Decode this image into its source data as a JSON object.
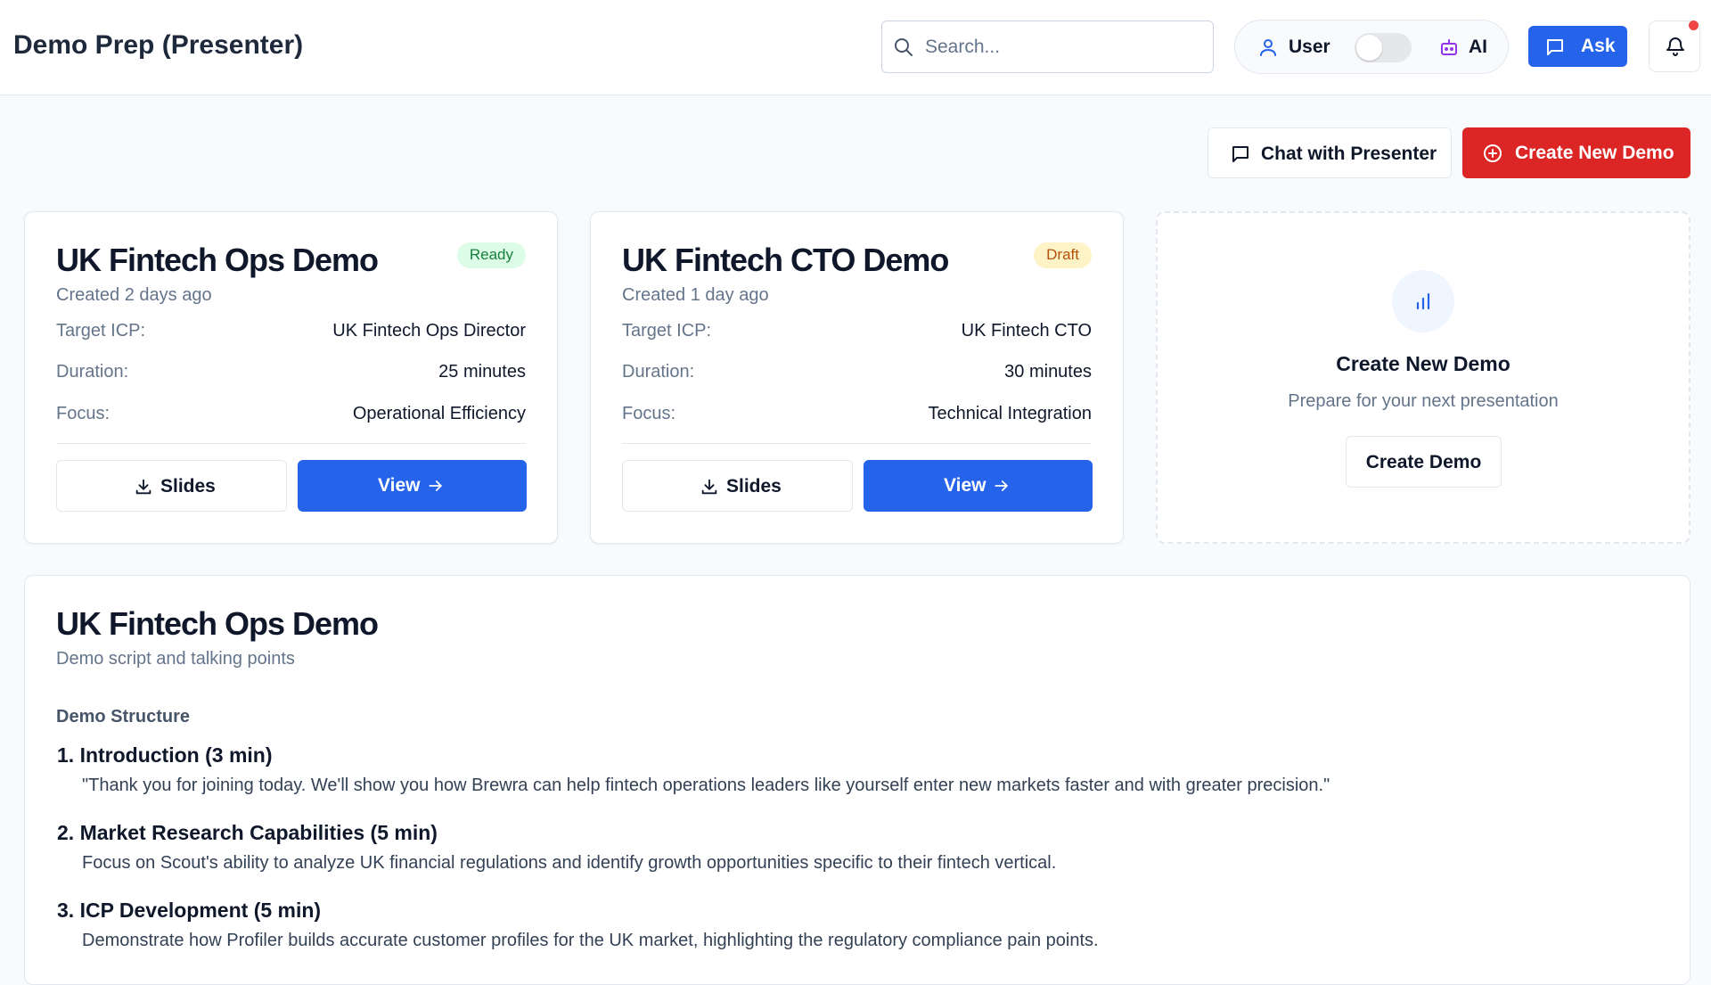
{
  "header": {
    "title": "Demo Prep (Presenter)",
    "search_placeholder": "Search...",
    "mode_user_label": "User",
    "mode_ai_label": "AI",
    "ask_label": "Ask",
    "icons": [
      "search-icon",
      "user-icon",
      "bot-icon",
      "message-icon",
      "bell-icon"
    ]
  },
  "actions": {
    "chat_label": "Chat with Presenter",
    "create_new_label": "Create New Demo"
  },
  "cards": [
    {
      "title": "UK Fintech Ops Demo",
      "status": "Ready",
      "created": "Created 2 days ago",
      "target_label": "Target ICP:",
      "target_value": "UK Fintech Ops Director",
      "duration_label": "Duration:",
      "duration_value": "25 minutes",
      "focus_label": "Focus:",
      "focus_value": "Operational Efficiency",
      "slides_label": "Slides",
      "view_label": "View"
    },
    {
      "title": "UK Fintech CTO Demo",
      "status": "Draft",
      "created": "Created 1 day ago",
      "target_label": "Target ICP:",
      "target_value": "UK Fintech CTO",
      "duration_label": "Duration:",
      "duration_value": "30 minutes",
      "focus_label": "Focus:",
      "focus_value": "Technical Integration",
      "slides_label": "Slides",
      "view_label": "View"
    }
  ],
  "placeholder": {
    "title": "Create New Demo",
    "subtitle": "Prepare for your next presentation",
    "button_label": "Create Demo"
  },
  "script": {
    "title": "UK Fintech Ops Demo",
    "subtitle": "Demo script and talking points",
    "structure_label": "Demo Structure",
    "steps": [
      {
        "heading": "1. Introduction (3 min)",
        "text": "\"Thank you for joining today. We'll show you how Brewra can help fintech operations leaders like yourself enter new markets faster and with greater precision.\""
      },
      {
        "heading": "2. Market Research Capabilities (5 min)",
        "text": "Focus on Scout's ability to analyze UK financial regulations and identify growth opportunities specific to their fintech vertical."
      },
      {
        "heading": "3. ICP Development (5 min)",
        "text": "Demonstrate how Profiler builds accurate customer profiles for the UK market, highlighting the regulatory compliance pain points."
      }
    ]
  },
  "colors": {
    "primary": "#2563eb",
    "danger": "#dc2626",
    "ready_bg": "#dcfce7",
    "ready_text": "#15803d",
    "draft_bg": "#fef3c7",
    "draft_text": "#b45309",
    "notification_dot": "#ef4444"
  }
}
